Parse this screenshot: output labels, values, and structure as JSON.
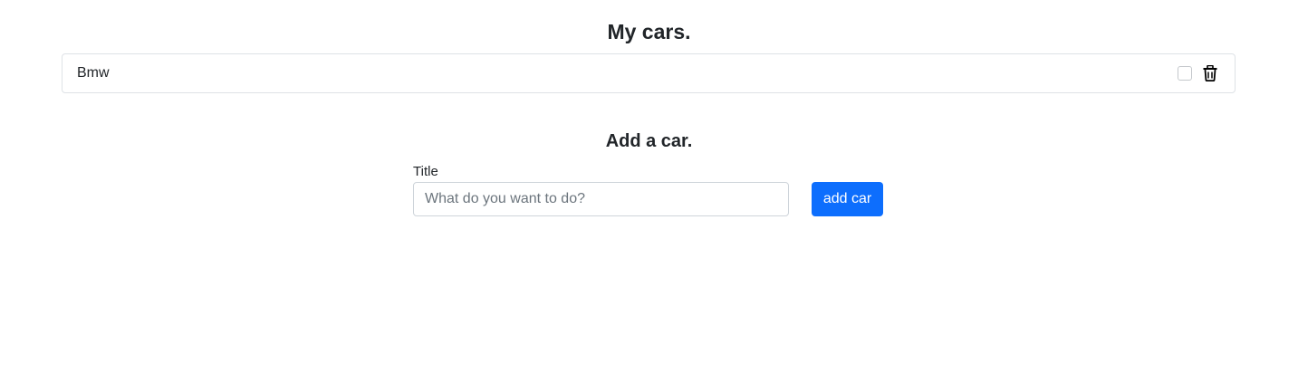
{
  "list": {
    "heading": "My cars.",
    "items": [
      {
        "title": "Bmw",
        "checked": false
      }
    ]
  },
  "form": {
    "heading": "Add a car.",
    "title_label": "Title",
    "title_placeholder": "What do you want to do?",
    "title_value": "",
    "submit_label": "add car"
  },
  "icons": {
    "delete": "trash-icon"
  },
  "colors": {
    "primary": "#0d6efd",
    "text": "#212529",
    "border": "#dee2e6"
  }
}
